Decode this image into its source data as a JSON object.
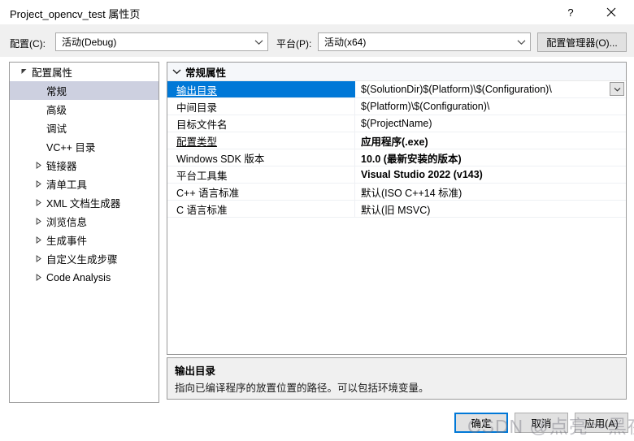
{
  "window": {
    "title": "Project_opencv_test 属性页",
    "help_icon": "question-mark-icon",
    "close_icon": "close-icon"
  },
  "config_bar": {
    "configuration_label": "配置(C):",
    "configuration_value": "活动(Debug)",
    "platform_label": "平台(P):",
    "platform_value": "活动(x64)",
    "config_manager_button": "配置管理器(O)..."
  },
  "tree": {
    "items": [
      {
        "label": "配置属性",
        "level": 0,
        "expander": "expanded",
        "selected": false
      },
      {
        "label": "常规",
        "level": 1,
        "expander": "none",
        "selected": true
      },
      {
        "label": "高级",
        "level": 1,
        "expander": "none",
        "selected": false
      },
      {
        "label": "调试",
        "level": 1,
        "expander": "none",
        "selected": false
      },
      {
        "label": "VC++ 目录",
        "level": 1,
        "expander": "none",
        "selected": false
      },
      {
        "label": "链接器",
        "level": 1,
        "expander": "collapsed",
        "selected": false
      },
      {
        "label": "清单工具",
        "level": 1,
        "expander": "collapsed",
        "selected": false
      },
      {
        "label": "XML 文档生成器",
        "level": 1,
        "expander": "collapsed",
        "selected": false
      },
      {
        "label": "浏览信息",
        "level": 1,
        "expander": "collapsed",
        "selected": false
      },
      {
        "label": "生成事件",
        "level": 1,
        "expander": "collapsed",
        "selected": false
      },
      {
        "label": "自定义生成步骤",
        "level": 1,
        "expander": "collapsed",
        "selected": false
      },
      {
        "label": "Code Analysis",
        "level": 1,
        "expander": "collapsed",
        "selected": false
      }
    ]
  },
  "grid": {
    "group_header": "常规属性",
    "rows": [
      {
        "name": "输出目录",
        "value": "$(SolutionDir)$(Platform)\\$(Configuration)\\",
        "selected": true,
        "underline": true,
        "bold_value": false,
        "has_dropdown": true
      },
      {
        "name": "中间目录",
        "value": "$(Platform)\\$(Configuration)\\",
        "selected": false,
        "underline": false,
        "bold_value": false,
        "has_dropdown": false
      },
      {
        "name": "目标文件名",
        "value": "$(ProjectName)",
        "selected": false,
        "underline": false,
        "bold_value": false,
        "has_dropdown": false
      },
      {
        "name": "配置类型",
        "value": "应用程序(.exe)",
        "selected": false,
        "underline": true,
        "bold_value": true,
        "has_dropdown": false
      },
      {
        "name": "Windows SDK 版本",
        "value": "10.0 (最新安装的版本)",
        "selected": false,
        "underline": false,
        "bold_value": true,
        "has_dropdown": false
      },
      {
        "name": "平台工具集",
        "value": "Visual Studio 2022 (v143)",
        "selected": false,
        "underline": false,
        "bold_value": true,
        "has_dropdown": false
      },
      {
        "name": "C++ 语言标准",
        "value": "默认(ISO C++14 标准)",
        "selected": false,
        "underline": false,
        "bold_value": false,
        "has_dropdown": false
      },
      {
        "name": "C 语言标准",
        "value": "默认(旧 MSVC)",
        "selected": false,
        "underline": false,
        "bold_value": false,
        "has_dropdown": false
      }
    ]
  },
  "description": {
    "title": "输出目录",
    "text": "指向已编译程序的放置位置的路径。可以包括环境变量。"
  },
  "footer": {
    "ok_label": "确定",
    "cancel_label": "取消",
    "apply_label": "应用(A)"
  },
  "watermark": {
    "text": "CSDN @点亮～黑夜"
  },
  "colors": {
    "selection_blue": "#0078d7",
    "tree_selection": "#cdd0e0",
    "dialog_gray": "#f0f0f0",
    "border_gray": "#9a9a9a"
  }
}
